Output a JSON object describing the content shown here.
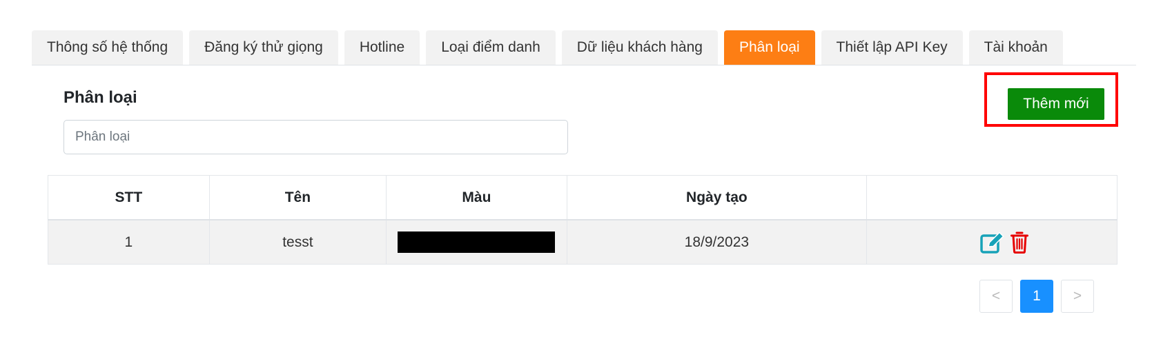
{
  "tabs": [
    {
      "label": "Thông số hệ thống",
      "active": false
    },
    {
      "label": "Đăng ký thử giọng",
      "active": false
    },
    {
      "label": "Hotline",
      "active": false
    },
    {
      "label": "Loại điểm danh",
      "active": false
    },
    {
      "label": "Dữ liệu khách hàng",
      "active": false
    },
    {
      "label": "Phân loại",
      "active": true
    },
    {
      "label": "Thiết lập API Key",
      "active": false
    },
    {
      "label": "Tài khoản",
      "active": false
    }
  ],
  "section": {
    "title": "Phân loại",
    "search_placeholder": "Phân loại",
    "add_button": "Thêm mới"
  },
  "table": {
    "headers": [
      "STT",
      "Tên",
      "Màu",
      "Ngày tạo",
      ""
    ],
    "rows": [
      {
        "stt": "1",
        "name": "tesst",
        "color": "#000000",
        "created": "18/9/2023"
      }
    ]
  },
  "pagination": {
    "prev": "<",
    "current": "1",
    "next": ">"
  },
  "icons": {
    "edit": "edit-icon",
    "delete": "trash-icon"
  },
  "colors": {
    "active_tab": "#fd7e14",
    "add_button": "#0a8a0a",
    "highlight": "#ff0000",
    "edit_icon": "#17a2b8",
    "delete_icon": "#e60000",
    "page_active": "#1890ff"
  }
}
